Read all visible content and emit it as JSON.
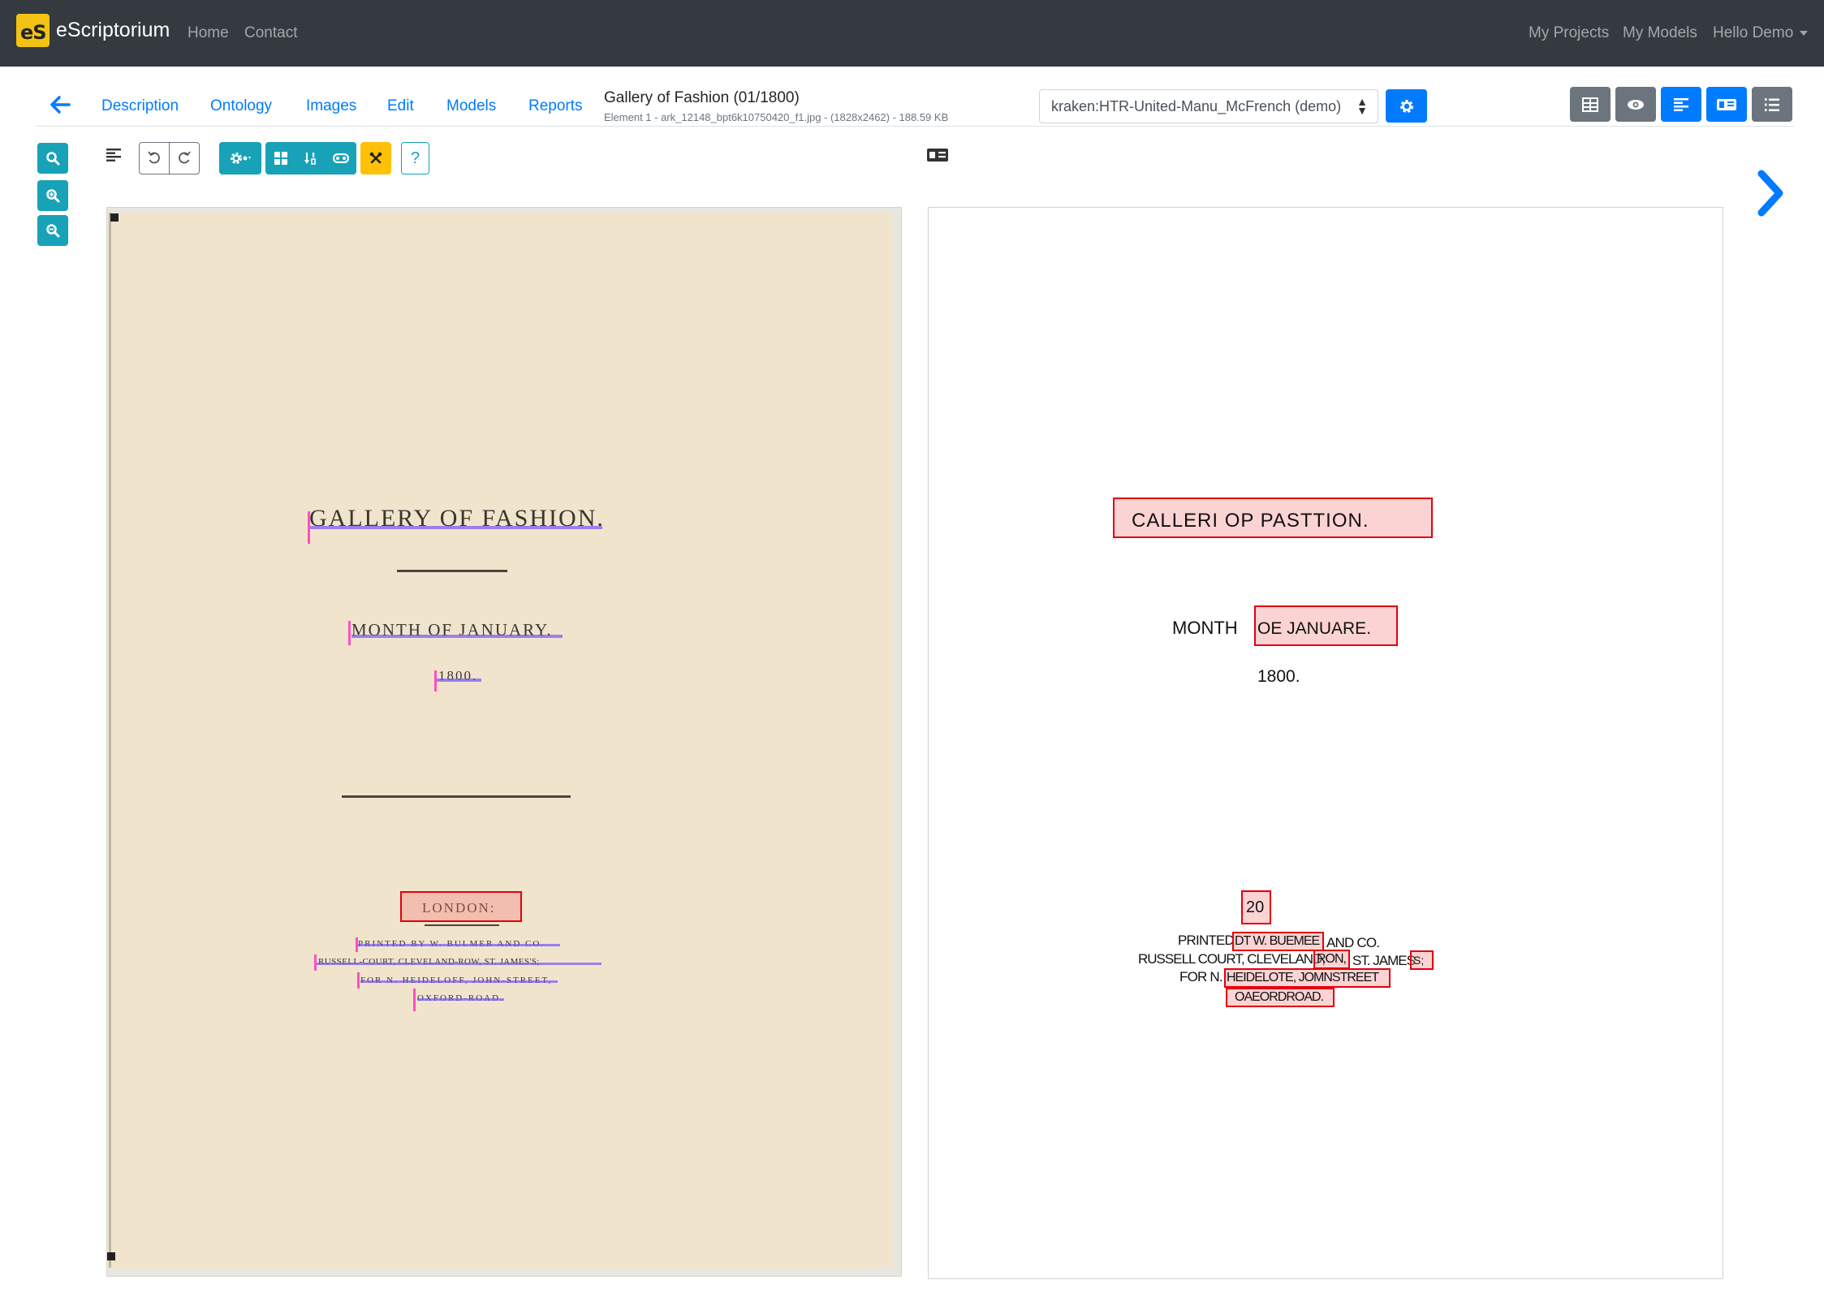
{
  "navbar": {
    "brand": "eScriptorium",
    "logo_text": "eS",
    "links": [
      "Home",
      "Contact"
    ],
    "right_links": [
      "My Projects",
      "My Models"
    ],
    "user_menu": "Hello Demo"
  },
  "header": {
    "tabs": [
      "Description",
      "Ontology",
      "Images",
      "Edit",
      "Models",
      "Reports"
    ],
    "title": "Gallery of Fashion (01/1800)",
    "subtitle": "Element 1 - ark_12148_bpt6k10750420_f1.jpg - (1828x2462) - 188.59 KB",
    "model_select": "kraken:HTR-United-Manu_McFrench (demo)"
  },
  "toolbar": {
    "help": "?"
  },
  "scan": {
    "lines": [
      "GALLERY OF FASHION.",
      "MONTH OF JANUARY.",
      "1800.",
      "LONDON:",
      "PRINTED BY W. BULMER AND CO.",
      "RUSSELL-COURT, CLEVELAND-ROW, ST. JAMES'S;",
      "FOR N. HEIDELOFF, JOHN-STREET,",
      "OXFORD-ROAD."
    ]
  },
  "transcription": {
    "line1": "CALLERI OP PASTTION.",
    "line2_pre": "MONTH",
    "line2_box": "OE JANUARE.",
    "line3": "1800.",
    "line4": "20",
    "line5_pre": "PRINTED",
    "line5_box": "DT W. BUEMEE",
    "line5_post": "AND CO.",
    "line6_pre": "RUSSELL COURT, CLEVELAND,",
    "line6_box1": "RON,",
    "line6_mid": "ST. JAMES",
    "line6_box2": "S;",
    "line7_pre": "FOR N.",
    "line7_box": "HEIDELOTE, JOMNSTREET",
    "line8_box": "OAEORDROAD."
  },
  "colors": {
    "navbar_bg": "#343a40",
    "primary": "#007bff",
    "info": "#17a2b8",
    "warning": "#ffc107",
    "secondary": "#6c757d",
    "error_box": "#e3000f",
    "baseline": "#6a4cff"
  }
}
